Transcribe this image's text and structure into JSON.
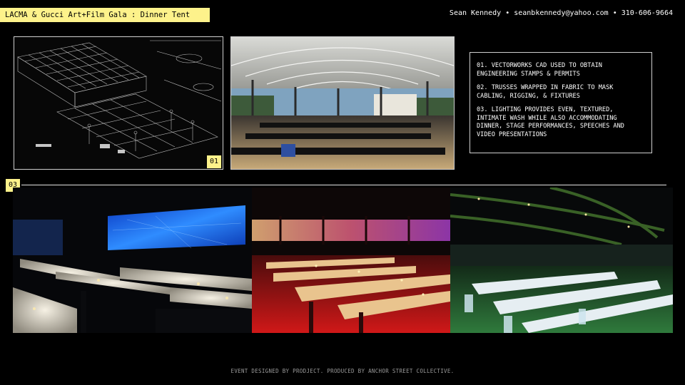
{
  "header": {
    "title": "LACMA & Gucci Art+Film Gala : Dinner Tent",
    "contact": "Sean Kennedy • seanbkennedy@yahoo.com • 310-606-9664"
  },
  "badges": {
    "cad": "01",
    "photos": "03"
  },
  "notes": {
    "items": [
      "01. VECTORWORKS CAD USED TO OBTAIN ENGINEERING STAMPS & PERMITS",
      "02. TRUSSES WRAPPED IN FABRIC TO MASK CABLING, RIGGING, & FIXTURES",
      "03. LIGHTING PROVIDES EVEN, TEXTURED, INTIMATE WASH WHILE ALSO ACCOMMODATING DINNER, STAGE PERFORMANCES, SPEECHES AND VIDEO PRESENTATIONS"
    ]
  },
  "footer": {
    "credit": "EVENT DESIGNED BY PRODJECT. PRODUCED BY ANCHOR STREET COLLECTIVE."
  },
  "colors": {
    "accent": "#fdf28b",
    "background": "#000000",
    "video_wall": "#1e6fe8",
    "red_wash": "#b31212",
    "green_floor": "#1f5a2e"
  }
}
